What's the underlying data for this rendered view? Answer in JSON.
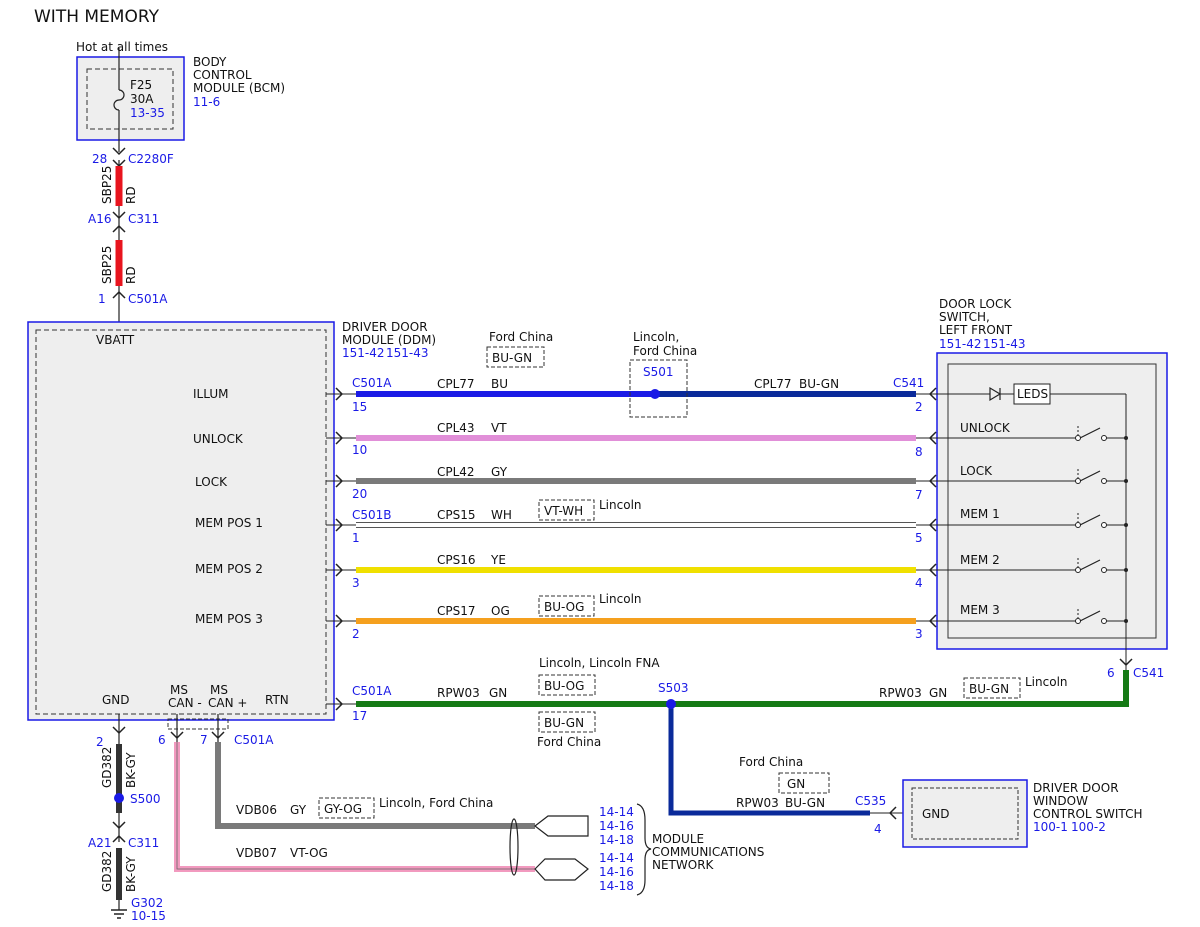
{
  "title": "WITH MEMORY",
  "colors": {
    "ref_blue": "#1a1ae6",
    "wire_red": "#e8141e",
    "wire_blue": "#1a1ae6",
    "wire_dark_blue": "#0a2a9a",
    "wire_violet": "#e18fd8",
    "wire_gray": "#7a7a7a",
    "wire_white": "#ffffff",
    "wire_yellow": "#f0e000",
    "wire_orange": "#f5a01e",
    "wire_green": "#157a15",
    "wire_pink": "#f29abf",
    "wire_black": "#333333"
  },
  "bcm": {
    "hot_label": "Hot at all times",
    "name_line1": "BODY",
    "name_line2": "CONTROL",
    "name_line3": "MODULE (BCM)",
    "ref": "11-6",
    "fuse_name": "F25",
    "fuse_rating": "30A",
    "fuse_ref": "13-35"
  },
  "feed": {
    "pin_top": "28",
    "conn_top": "C2280F",
    "circuit1": "SBP25",
    "color1": "RD",
    "pin_mid": "A16",
    "conn_mid": "C311",
    "circuit2": "SBP25",
    "color2": "RD",
    "pin_bottom": "1",
    "conn_bottom": "C501A"
  },
  "ddm": {
    "name_line1": "DRIVER DOOR",
    "name_line2": "MODULE (DDM)",
    "ref1": "151-42",
    "ref2": "151-43",
    "vbatt": "VBATT",
    "illum": "ILLUM",
    "unlock": "UNLOCK",
    "lock": "LOCK",
    "mem1": "MEM POS 1",
    "mem2": "MEM POS 2",
    "mem3": "MEM POS 3",
    "gnd": "GND",
    "ms_can_minus_1": "MS",
    "ms_can_minus_2": "CAN -",
    "ms_can_plus_1": "MS",
    "ms_can_plus_2": "CAN +",
    "rtn": "RTN"
  },
  "switch": {
    "name_line1": "DOOR LOCK",
    "name_line2": "SWITCH,",
    "name_line3": "LEFT FRONT",
    "ref1": "151-42",
    "ref2": "151-43",
    "leds": "LEDS",
    "unlock": "UNLOCK",
    "lock": "LOCK",
    "mem1": "MEM 1",
    "mem2": "MEM 2",
    "mem3": "MEM 3",
    "bottom_pin": "6",
    "bottom_conn": "C541"
  },
  "wires": {
    "conn_left_a": "C501A",
    "conn_left_b": "C501B",
    "conn_right": "C541",
    "illum_pin_left": "15",
    "illum_circuit": "CPL77",
    "illum_color": "BU",
    "illum_variant_label": "Ford China",
    "illum_variant_color": "BU-GN",
    "splice_label1": "Lincoln,",
    "splice_label2": "Ford China",
    "splice_id": "S501",
    "illum_circuit_right": "CPL77",
    "illum_color_right": "BU-GN",
    "illum_pin_right": "2",
    "unlock_pin_left": "10",
    "unlock_circuit": "CPL43",
    "unlock_color": "VT",
    "unlock_pin_right": "8",
    "lock_pin_left": "20",
    "lock_circuit": "CPL42",
    "lock_color": "GY",
    "lock_pin_right": "7",
    "mem1_pin_left": "1",
    "mem1_circuit": "CPS15",
    "mem1_color": "WH",
    "mem1_variant_color": "VT-WH",
    "mem1_variant_label": "Lincoln",
    "mem1_pin_right": "5",
    "mem2_pin_left": "3",
    "mem2_circuit": "CPS16",
    "mem2_color": "YE",
    "mem2_pin_right": "4",
    "mem3_pin_left": "2",
    "mem3_circuit": "CPS17",
    "mem3_color": "OG",
    "mem3_variant_color": "BU-OG",
    "mem3_variant_label": "Lincoln",
    "mem3_pin_right": "3",
    "rtn_conn": "C501A",
    "rtn_pin_left": "17",
    "rtn_circuit": "RPW03",
    "rtn_color": "GN",
    "rtn_variant_top_label": "Lincoln, Lincoln FNA",
    "rtn_variant_top_color": "BU-OG",
    "rtn_variant_bottom_color": "BU-GN",
    "rtn_variant_bottom_label": "Ford China",
    "splice2_id": "S503",
    "rtn_circuit_right": "RPW03",
    "rtn_color_right": "GN",
    "rtn_variant_right_color": "BU-GN",
    "rtn_variant_right_label": "Lincoln"
  },
  "gnd": {
    "pin_top": "2",
    "circuit1": "GD382",
    "color1": "BK-GY",
    "splice": "S500",
    "pin_mid": "A21",
    "conn_mid": "C311",
    "circuit2": "GD382",
    "color2": "BK-GY",
    "ground_id": "G302",
    "ground_ref": "10-15"
  },
  "can": {
    "pin_minus": "6",
    "pin_plus": "7",
    "conn": "C501A",
    "vdb06_circuit": "VDB06",
    "vdb06_color": "GY",
    "vdb06_variant_color": "GY-OG",
    "vdb06_variant_label": "Lincoln, Ford China",
    "vdb07_circuit": "VDB07",
    "vdb07_color": "VT-OG",
    "ref_a1": "14-14",
    "ref_a2": "14-16",
    "ref_a3": "14-18",
    "ref_b1": "14-14",
    "ref_b2": "14-16",
    "ref_b3": "14-18",
    "network_line1": "MODULE",
    "network_line2": "COMMUNICATIONS",
    "network_line3": "NETWORK"
  },
  "window_switch": {
    "variant_label": "Ford China",
    "variant_color": "GN",
    "circuit": "RPW03",
    "color": "BU-GN",
    "conn": "C535",
    "pin": "4",
    "gnd": "GND",
    "name_line1": "DRIVER DOOR",
    "name_line2": "WINDOW",
    "name_line3": "CONTROL SWITCH",
    "ref1": "100-1",
    "ref2": "100-2"
  }
}
